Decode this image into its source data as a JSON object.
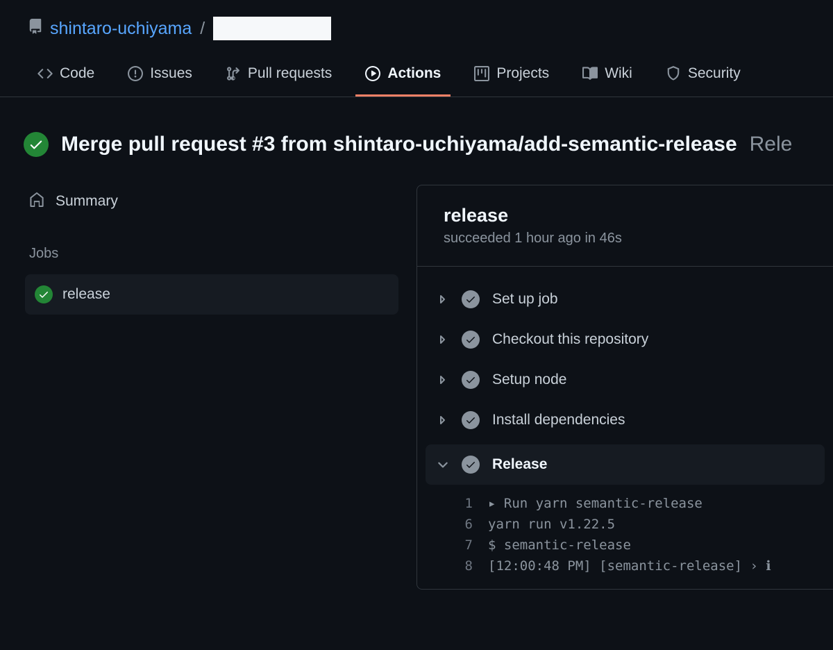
{
  "breadcrumb": {
    "owner": "shintaro-uchiyama",
    "separator": "/"
  },
  "tabs": {
    "code": "Code",
    "issues": "Issues",
    "pulls": "Pull requests",
    "actions": "Actions",
    "projects": "Projects",
    "wiki": "Wiki",
    "security": "Security"
  },
  "workflow": {
    "title": "Merge pull request #3 from shintaro-uchiyama/add-semantic-release",
    "suffix": "Rele"
  },
  "sidebar": {
    "summary": "Summary",
    "jobs_label": "Jobs",
    "job_release": "release"
  },
  "job": {
    "title": "release",
    "subtitle": "succeeded 1 hour ago in 46s",
    "steps": {
      "setup_job": "Set up job",
      "checkout": "Checkout this repository",
      "setup_node": "Setup node",
      "install": "Install dependencies",
      "release": "Release"
    },
    "log": [
      {
        "n": "1",
        "text": "▸ Run yarn semantic-release"
      },
      {
        "n": "6",
        "text": "yarn run v1.22.5"
      },
      {
        "n": "7",
        "text": "$ semantic-release"
      },
      {
        "n": "8",
        "text": "[12:00:48 PM] [semantic-release] › ℹ"
      }
    ]
  }
}
